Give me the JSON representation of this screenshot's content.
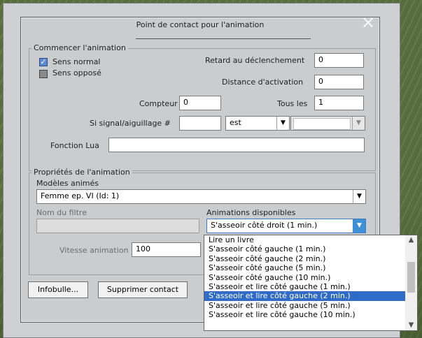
{
  "dialog": {
    "title": "Point de contact pour l'animation",
    "close_glyph": "✕"
  },
  "start_group": {
    "legend": "Commencer l'animation",
    "normal_label": "Sens normal",
    "normal_checked": true,
    "reverse_label": "Sens opposé",
    "reverse_checked": false,
    "delay_label": "Retard au déclenchement",
    "delay_value": "0",
    "distance_label": "Distance d'activation",
    "distance_value": "0",
    "counter_label": "Compteur",
    "counter_value": "0",
    "every_label": "Tous les",
    "every_value": "1",
    "signal_label": "Si signal/aiguillage #",
    "signal_value": "",
    "signal_state": "est",
    "lua_label": "Fonction Lua",
    "lua_value": ""
  },
  "props_group": {
    "legend": "Propriétés de l'animation",
    "models_label": "Modèles animés",
    "model_value": "Femme ep. VI (Id: 1)",
    "filter_label": "Nom du filtre",
    "filter_value": "",
    "anims_label": "Animations disponibles",
    "anim_value": "S'asseoir côté droit (1 min.)",
    "speed_label": "Vitesse animation",
    "speed_value": "100"
  },
  "buttons": {
    "tooltip": "Infobulle...",
    "delete": "Supprimer contact"
  },
  "dropdown": {
    "items": [
      "Lire un livre",
      "S'asseoir côté gauche (1 min.)",
      "S'asseoir côté gauche (2 min.)",
      "S'asseoir côté gauche (5 min.)",
      "S'asseoir côté gauche (10 min.)",
      "S'asseoir et lire côté gauche (1 min.)",
      "S'asseoir et lire côté gauche (2 min.)",
      "S'asseoir et lire côté gauche (5 min.)",
      "S'asseoir et lire côté gauche (10 min.)"
    ],
    "selected_index": 6
  },
  "icons": {
    "dropdown_arrow": "chevron-down-icon",
    "scroll_up": "chevron-up-icon",
    "scroll_down": "chevron-down-icon"
  },
  "colors": {
    "selection": "#2f6bc7",
    "focus_arrow": "#3d8fd6"
  }
}
